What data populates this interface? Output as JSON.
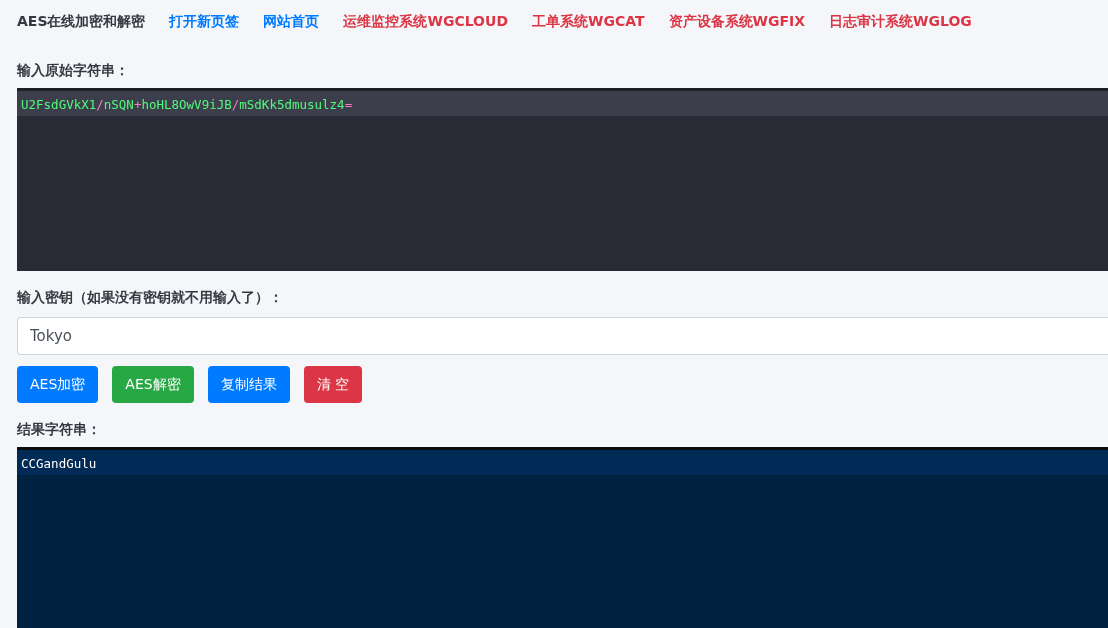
{
  "nav": [
    {
      "label": "AES在线加密和解密",
      "color": "#343a40"
    },
    {
      "label": "打开新页签",
      "color": "#007bff"
    },
    {
      "label": "网站首页",
      "color": "#007bff"
    },
    {
      "label": "运维监控系统WGCLOUD",
      "color": "#dc3545"
    },
    {
      "label": "工单系统WGCAT",
      "color": "#dc3545"
    },
    {
      "label": "资产设备系统WGFIX",
      "color": "#dc3545"
    },
    {
      "label": "日志审计系统WGLOG",
      "color": "#dc3545"
    }
  ],
  "input_label": "输入原始字符串：",
  "input_editor": {
    "tokens": [
      {
        "text": "U2FsdGVkX1",
        "kind": "word"
      },
      {
        "text": "/",
        "kind": "symbol"
      },
      {
        "text": "nSQN",
        "kind": "word"
      },
      {
        "text": "+",
        "kind": "symbol"
      },
      {
        "text": "hoHL8OwV9iJB",
        "kind": "word"
      },
      {
        "text": "/",
        "kind": "symbol"
      },
      {
        "text": "mSdKk5dmusulz4",
        "kind": "word"
      },
      {
        "text": "=",
        "kind": "symbol"
      }
    ]
  },
  "key_label": "输入密钥（如果没有密钥就不用输入了）：",
  "key_field": {
    "value": "Tokyo"
  },
  "buttons": [
    {
      "label": "AES加密",
      "kind": "primary"
    },
    {
      "label": "AES解密",
      "kind": "success"
    },
    {
      "label": "复制结果",
      "kind": "primary"
    },
    {
      "label": "清 空",
      "kind": "danger"
    }
  ],
  "result_label": "结果字符串：",
  "result_editor": {
    "text": "CCGandGulu"
  }
}
